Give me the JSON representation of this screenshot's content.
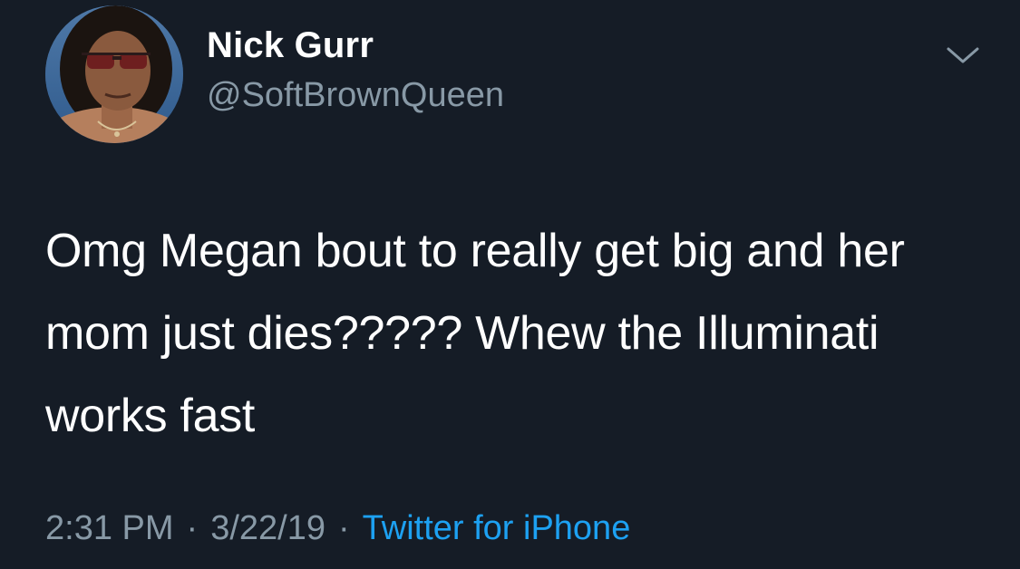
{
  "tweet": {
    "author": {
      "display_name": "Nick Gurr",
      "handle": "@SoftBrownQueen",
      "avatar_icon": "profile-photo"
    },
    "menu_icon": "chevron-down-icon",
    "text": "Omg Megan bout to really get big and her mom just dies????? Whew the Illuminati works fast",
    "time": "2:31 PM",
    "date": "3/22/19",
    "separator": "·",
    "source": "Twitter for iPhone"
  },
  "colors": {
    "background": "#151c26",
    "primary_text": "#ffffff",
    "secondary_text": "#8899a6",
    "link": "#1da1f2"
  }
}
